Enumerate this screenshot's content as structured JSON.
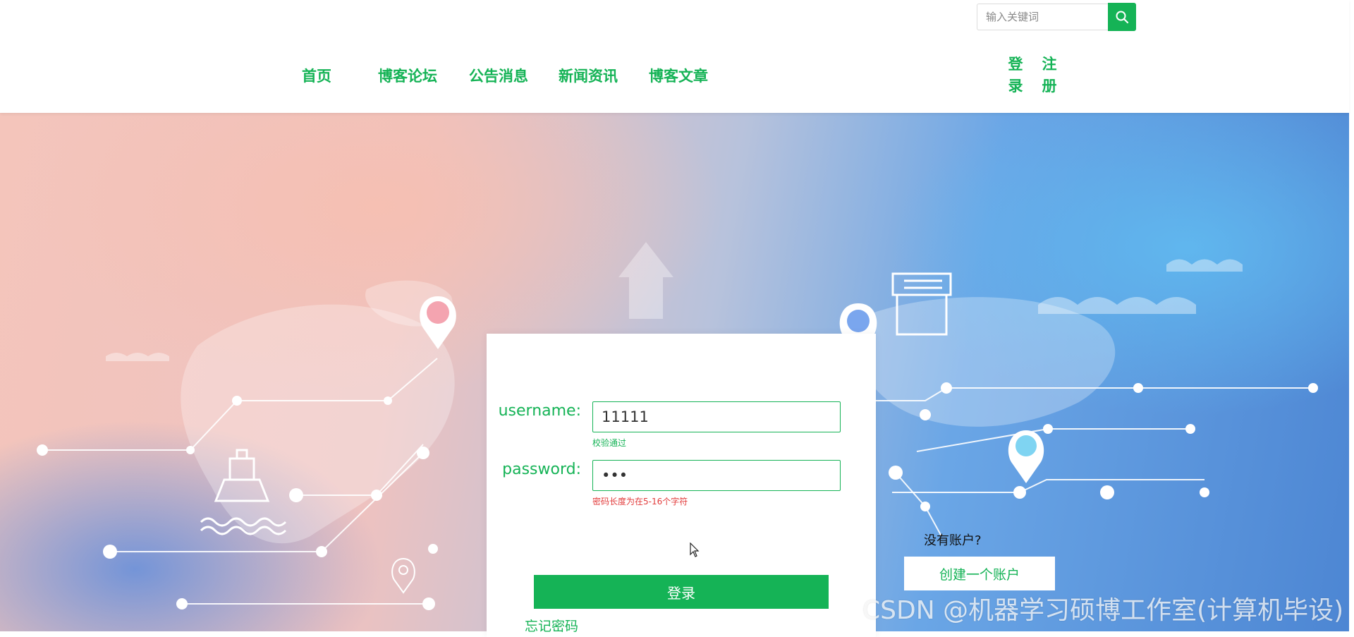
{
  "search": {
    "placeholder": "输入关键词",
    "value": ""
  },
  "nav": {
    "items": [
      {
        "label": "首页"
      },
      {
        "label": "博客论坛"
      },
      {
        "label": "公告消息"
      },
      {
        "label": "新闻资讯"
      },
      {
        "label": "博客文章"
      }
    ]
  },
  "auth": {
    "login_top": "登",
    "login_bottom": "录",
    "register_top": "注",
    "register_bottom": "册"
  },
  "form": {
    "username_label": "username:",
    "username_value": "11111",
    "username_hint": "校验通过",
    "password_label": "password:",
    "password_value": "•••",
    "password_hint": "密码长度为在5-16个字符",
    "login_button": "登录",
    "forgot_link": "忘记密码"
  },
  "signup": {
    "prompt": "没有账户?",
    "create_button": "创建一个账户"
  },
  "watermark": "CSDN @机器学习硕博工作室(计算机毕设)",
  "colors": {
    "brand": "#15b356",
    "error": "#e23b3b"
  },
  "icons": [
    "search-icon",
    "location-pin-icon",
    "ship-icon",
    "package-icon",
    "upload-arrow-icon",
    "mouse-cursor-icon"
  ]
}
